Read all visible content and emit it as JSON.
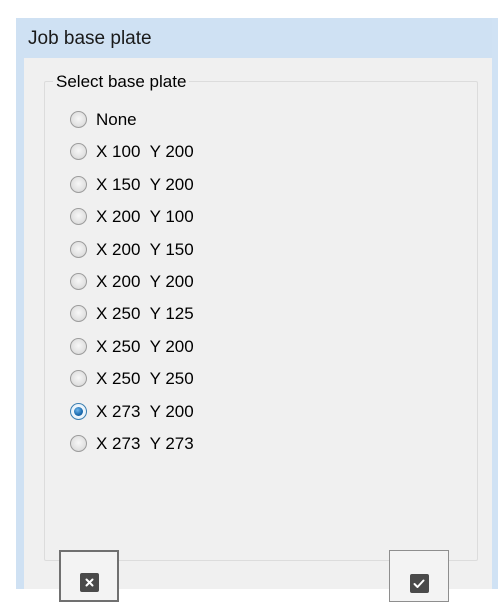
{
  "window": {
    "title": "Job base plate"
  },
  "groupbox": {
    "legend": "Select base plate"
  },
  "options": [
    {
      "label": "None",
      "checked": false
    },
    {
      "label": "X 100  Y 200",
      "checked": false
    },
    {
      "label": "X 150  Y 200",
      "checked": false
    },
    {
      "label": "X 200  Y 100",
      "checked": false
    },
    {
      "label": "X 200  Y 150",
      "checked": false
    },
    {
      "label": "X 200  Y 200",
      "checked": false
    },
    {
      "label": "X 250  Y 125",
      "checked": false
    },
    {
      "label": "X 250  Y 200",
      "checked": false
    },
    {
      "label": "X 250  Y 250",
      "checked": false
    },
    {
      "label": "X 273  Y 200",
      "checked": true
    },
    {
      "label": "X 273  Y 273",
      "checked": false
    }
  ],
  "buttons": {
    "cancel_icon": "close-icon",
    "ok_icon": "checkmark-icon"
  },
  "colors": {
    "title_bar": "#cfe1f3",
    "client": "#f0f0f0",
    "radio_selected": "#1f6fb3",
    "button_icon": "#4a4a4a"
  }
}
